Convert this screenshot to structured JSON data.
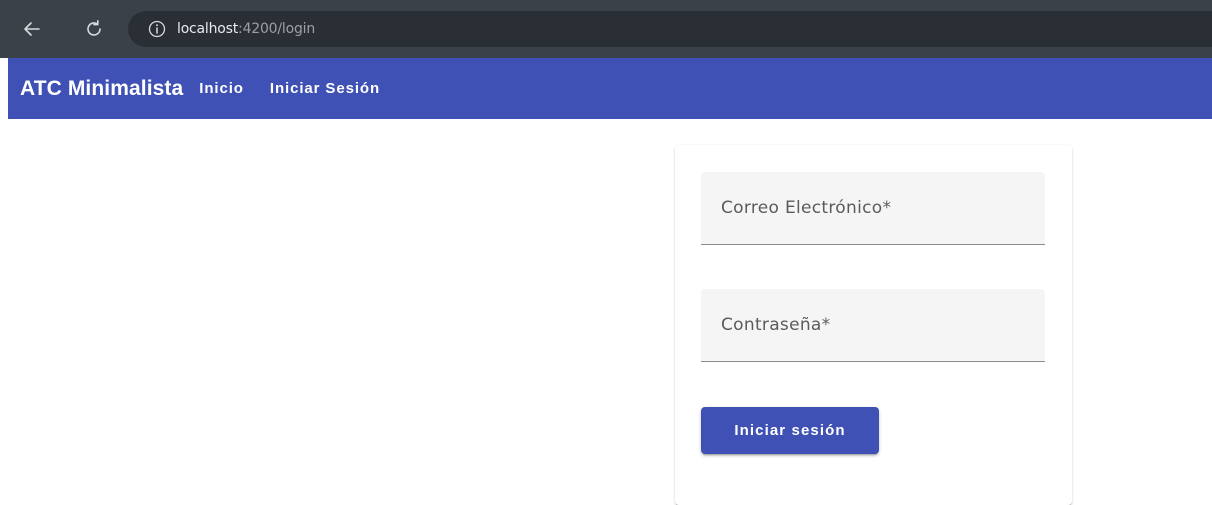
{
  "browser": {
    "url_host": "localhost",
    "url_rest": ":4200/login",
    "icons": {
      "back": "arrow-left-icon",
      "reload": "reload-icon",
      "info": "info-icon"
    }
  },
  "toolbar": {
    "brand": "ATC Minimalista",
    "nav": {
      "home": "Inicio",
      "login": "Iniciar Sesión"
    },
    "color": "#3f51b5"
  },
  "login_form": {
    "email_placeholder": "Correo Electrónico*",
    "email_value": "",
    "password_placeholder": "Contraseña*",
    "password_value": "",
    "submit_label": "Iniciar sesión",
    "button_color": "#3f51b5"
  }
}
